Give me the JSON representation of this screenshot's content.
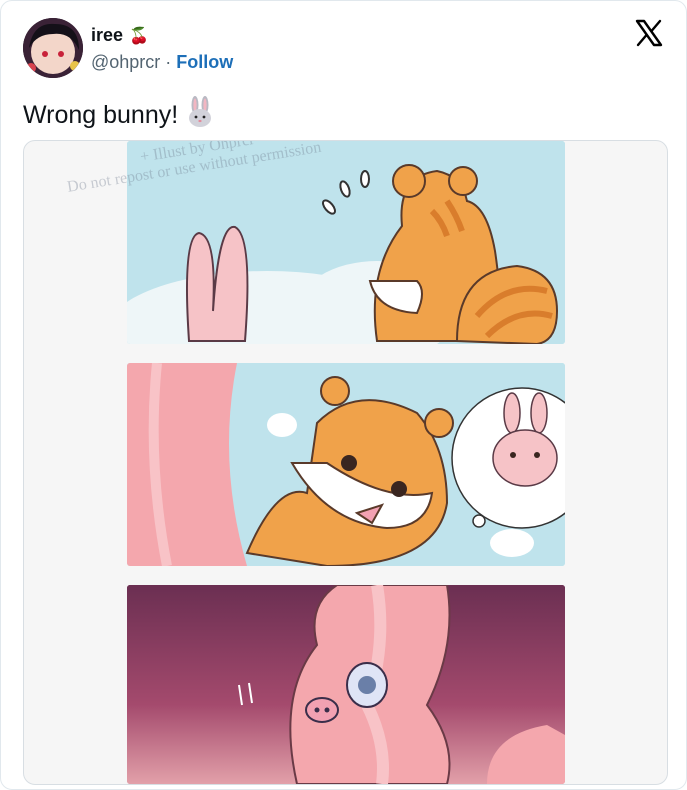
{
  "tweet": {
    "author_name": "iree",
    "name_emoji": "🍒",
    "handle": "@ohprcr",
    "separator": "·",
    "follow_label": "Follow",
    "text": "Wrong bunny!",
    "text_emoji": "rabbit-face"
  },
  "media": {
    "watermark_line1": "+ Illust by Ohprcr",
    "watermark_line2": "Do not repost or use without permission"
  },
  "colors": {
    "follow": "#1d6fb8",
    "panel_sky": "#bfe3ec",
    "squirrel_orange": "#f0a24a",
    "bunny_pink": "#f6c3c7"
  },
  "icons": {
    "platform": "x-logo-icon",
    "avatar": "user-avatar"
  }
}
